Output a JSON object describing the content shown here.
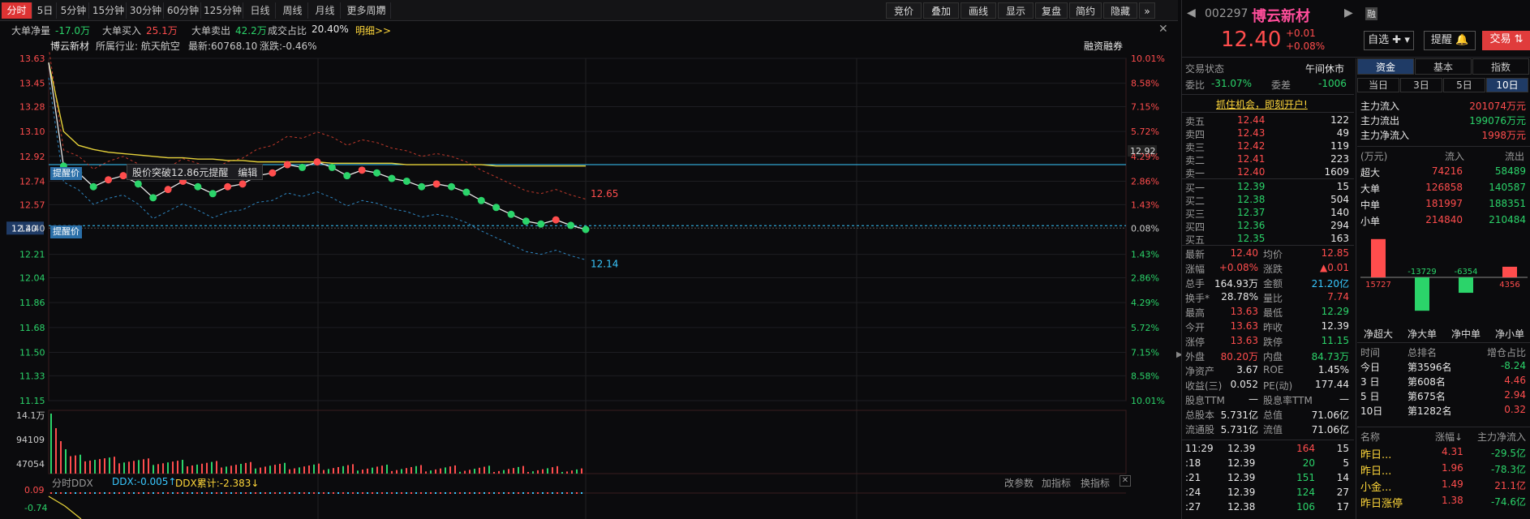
{
  "toolbar": {
    "periods": [
      "分时",
      "5日",
      "5分钟",
      "15分钟",
      "30分钟",
      "60分钟",
      "125分钟",
      "日线",
      "周线",
      "月线",
      "更多周期"
    ],
    "right_buttons": [
      "竞价",
      "叠加",
      "画线",
      "显示",
      "复盘",
      "简约",
      "隐藏"
    ],
    "period_dropdown_icon": "triangle-down-icon",
    "expand_icon": "double-chevron-icon"
  },
  "info_bar": {
    "da_dan_jingliang": "大单净量",
    "da_dan_jingliang_val": "-17.0万",
    "da_dan_mairu": "大单买入",
    "da_dan_mairu_val": "25.1万",
    "da_dan_maichu": "大单卖出",
    "da_dan_maichu_val": "42.2万",
    "chengjiao_zhanbi": "成交占比",
    "chengjiao_zhanbi_val": "20.40%",
    "mingxi": "明细>>"
  },
  "chart_header": {
    "name": "博云新材",
    "industry": "所属行业: 航天航空",
    "latest": "最新:60768.10",
    "change": "涨跌:-0.46%",
    "rzrq": "融资融券"
  },
  "chart_labels": {
    "left_ticks": [
      "13.63",
      "13.45",
      "13.28",
      "13.10",
      "12.92",
      "12.74",
      "12.57",
      "12.40",
      "12.21",
      "12.04",
      "11.86",
      "11.68",
      "11.50",
      "11.33",
      "11.15"
    ],
    "right_ticks": [
      "10.01%",
      "8.58%",
      "7.15%",
      "5.72%",
      "4.29%",
      "2.86%",
      "1.43%",
      "0.08%",
      "1.43%",
      "2.86%",
      "4.29%",
      "5.72%",
      "7.15%",
      "8.58%",
      "10.01%"
    ],
    "price_line_label": "12.92",
    "upper_band_label": "12.65",
    "lower_band_label": "12.14",
    "alert_tag": "提醒价",
    "alert_tag2": "提醒价",
    "alert_text": "股价突破12.86元提醒",
    "alert_edit": "编辑",
    "vol_ticks": [
      "14.1万",
      "94109",
      "47054"
    ],
    "ddx_ticks": [
      "0.09",
      "-0.74"
    ],
    "ddx_title": "分时DDX",
    "ddx_val": "DDX:-0.005↑",
    "ddx_cum": "DDX累计:-2.383↓",
    "ddx_buttons": [
      "改参数",
      "加指标",
      "换指标"
    ]
  },
  "chart_data": {
    "type": "line",
    "title": "",
    "ylim": [
      11.15,
      13.63
    ],
    "series": [
      {
        "name": "",
        "values": [
          13.6,
          12.85,
          12.8,
          12.7,
          12.75,
          12.78,
          12.72,
          12.62,
          12.68,
          12.74,
          12.7,
          12.65,
          12.7,
          12.72,
          12.78,
          12.8,
          12.86,
          12.84,
          12.88,
          12.84,
          12.78,
          12.82,
          12.8,
          12.76,
          12.74,
          12.7,
          12.72,
          12.7,
          12.66,
          12.6,
          12.55,
          12.5,
          12.45,
          12.43,
          12.46,
          12.42,
          12.39
        ]
      },
      {
        "name": "",
        "values": [
          13.6,
          13.1,
          13.0,
          12.97,
          12.95,
          12.94,
          12.93,
          12.92,
          12.91,
          12.91,
          12.9,
          12.9,
          12.89,
          12.89,
          12.88,
          12.88,
          12.88,
          12.88,
          12.88,
          12.87,
          12.87,
          12.87,
          12.87,
          12.87,
          12.86,
          12.86,
          12.86,
          12.86,
          12.86,
          12.86,
          12.85,
          12.85,
          12.85,
          12.85,
          12.85,
          12.85,
          12.85
        ]
      }
    ]
  },
  "quote": {
    "code": "002297",
    "name": "博云新材",
    "price": "12.40",
    "change": "+0.01",
    "change_pct": "+0.08%",
    "rong_badge": "融",
    "zixuan": "自选",
    "tixing": "提醒",
    "jiaoyi": "交易",
    "jiaoyi_state_label": "交易状态",
    "jiaoyi_state": "午间休市",
    "weibi_label": "委比",
    "weibi": "-31.07%",
    "weicha_label": "委差",
    "weicha": "-1006",
    "promo": "抓住机会，即刻开户!"
  },
  "order_book": {
    "sells": [
      {
        "label": "卖五",
        "price": "12.44",
        "vol": "122"
      },
      {
        "label": "卖四",
        "price": "12.43",
        "vol": "49"
      },
      {
        "label": "卖三",
        "price": "12.42",
        "vol": "119"
      },
      {
        "label": "卖二",
        "price": "12.41",
        "vol": "223"
      },
      {
        "label": "卖一",
        "price": "12.40",
        "vol": "1609"
      }
    ],
    "buys": [
      {
        "label": "买一",
        "price": "12.39",
        "vol": "15"
      },
      {
        "label": "买二",
        "price": "12.38",
        "vol": "504"
      },
      {
        "label": "买三",
        "price": "12.37",
        "vol": "140"
      },
      {
        "label": "买四",
        "price": "12.36",
        "vol": "294"
      },
      {
        "label": "买五",
        "price": "12.35",
        "vol": "163"
      }
    ]
  },
  "stats": {
    "left": [
      {
        "label": "最新",
        "val": "12.40",
        "c": "red"
      },
      {
        "label": "涨幅",
        "val": "+0.08%",
        "c": "red"
      },
      {
        "label": "总手",
        "val": "164.93万",
        "c": "white"
      },
      {
        "label": "换手*",
        "val": "28.78%",
        "c": "white"
      },
      {
        "label": "最高",
        "val": "13.63",
        "c": "red"
      },
      {
        "label": "今开",
        "val": "13.63",
        "c": "red"
      },
      {
        "label": "涨停",
        "val": "13.63",
        "c": "red"
      },
      {
        "label": "外盘",
        "val": "80.20万",
        "c": "red"
      },
      {
        "label": "净资产",
        "val": "3.67",
        "c": "white"
      },
      {
        "label": "收益(三)",
        "val": "0.052",
        "c": "white"
      },
      {
        "label": "股息TTM",
        "val": "—",
        "c": "white"
      },
      {
        "label": "总股本",
        "val": "5.731亿",
        "c": "white"
      },
      {
        "label": "流通股",
        "val": "5.731亿",
        "c": "white"
      }
    ],
    "right": [
      {
        "label": "均价",
        "val": "12.85",
        "c": "red"
      },
      {
        "label": "涨跌",
        "val": "▲0.01",
        "c": "red"
      },
      {
        "label": "金额",
        "val": "21.20亿",
        "c": "cyan"
      },
      {
        "label": "量比",
        "val": "7.74",
        "c": "red"
      },
      {
        "label": "最低",
        "val": "12.29",
        "c": "green"
      },
      {
        "label": "昨收",
        "val": "12.39",
        "c": "white"
      },
      {
        "label": "跌停",
        "val": "11.15",
        "c": "green"
      },
      {
        "label": "内盘",
        "val": "84.73万",
        "c": "green"
      },
      {
        "label": "ROE",
        "val": "1.45%",
        "c": "white"
      },
      {
        "label": "PE(动)",
        "val": "177.44",
        "c": "white"
      },
      {
        "label": "股息率TTM",
        "val": "—",
        "c": "white"
      },
      {
        "label": "总值",
        "val": "71.06亿",
        "c": "white"
      },
      {
        "label": "流值",
        "val": "71.06亿",
        "c": "white"
      }
    ]
  },
  "ticks": [
    {
      "time": "11:29",
      "price": "12.39",
      "vol": "164",
      "n": "15",
      "vc": "red"
    },
    {
      "time": ":18",
      "price": "12.39",
      "vol": "20",
      "n": "5",
      "vc": "green"
    },
    {
      "time": ":21",
      "price": "12.39",
      "vol": "151",
      "n": "14",
      "vc": "green"
    },
    {
      "time": ":24",
      "price": "12.39",
      "vol": "124",
      "n": "27",
      "vc": "green"
    },
    {
      "time": ":27",
      "price": "12.38",
      "vol": "106",
      "n": "17",
      "vc": "green"
    }
  ],
  "fund": {
    "tabs": [
      "资金",
      "基本",
      "指数"
    ],
    "days": [
      "当日",
      "3日",
      "5日",
      "10日"
    ],
    "rows": [
      {
        "label": "主力流入",
        "val": "201074万元",
        "c": "red"
      },
      {
        "label": "主力流出",
        "val": "199076万元",
        "c": "green"
      },
      {
        "label": "主力净流入",
        "val": "1998万元",
        "c": "red"
      }
    ],
    "unit": "(万元)",
    "col_in": "流入",
    "col_out": "流出",
    "flow": [
      {
        "label": "超大",
        "in": "74216",
        "out": "58489"
      },
      {
        "label": "大单",
        "in": "126858",
        "out": "140587"
      },
      {
        "label": "中单",
        "in": "181997",
        "out": "188351"
      },
      {
        "label": "小单",
        "in": "214840",
        "out": "210484"
      }
    ],
    "net_bars": [
      {
        "label": "净超大",
        "value": 15727,
        "text": "15727"
      },
      {
        "label": "净大单",
        "value": -13729,
        "text": "-13729"
      },
      {
        "label": "净中单",
        "value": -6354,
        "text": "-6354"
      },
      {
        "label": "净小单",
        "value": 4356,
        "text": "4356"
      }
    ],
    "rank_header": [
      "时间",
      "总排名",
      "增仓占比"
    ],
    "ranks": [
      {
        "t": "今日",
        "r": "第3596名",
        "v": "-8.24",
        "c": "green"
      },
      {
        "t": "3 日",
        "r": "第608名",
        "v": "4.46",
        "c": "red"
      },
      {
        "t": "5 日",
        "r": "第675名",
        "v": "2.94",
        "c": "red"
      },
      {
        "t": "10日",
        "r": "第1282名",
        "v": "0.32",
        "c": "red"
      }
    ],
    "list_header": [
      "名称",
      "涨幅↓",
      "主力净流入"
    ],
    "list": [
      {
        "n": "昨日...",
        "p": "4.31",
        "f": "-29.5亿"
      },
      {
        "n": "昨日...",
        "p": "1.96",
        "f": "-78.3亿"
      },
      {
        "n": "小金...",
        "p": "1.49",
        "f": "21.1亿"
      },
      {
        "n": "昨日涨停",
        "p": "1.38",
        "f": "-74.6亿"
      }
    ]
  },
  "colors": {
    "red": "#ff4d4d",
    "green": "#2bd46a",
    "yellow": "#ffd73a",
    "cyan": "#38c8ff",
    "bg": "#0b0b0d"
  }
}
